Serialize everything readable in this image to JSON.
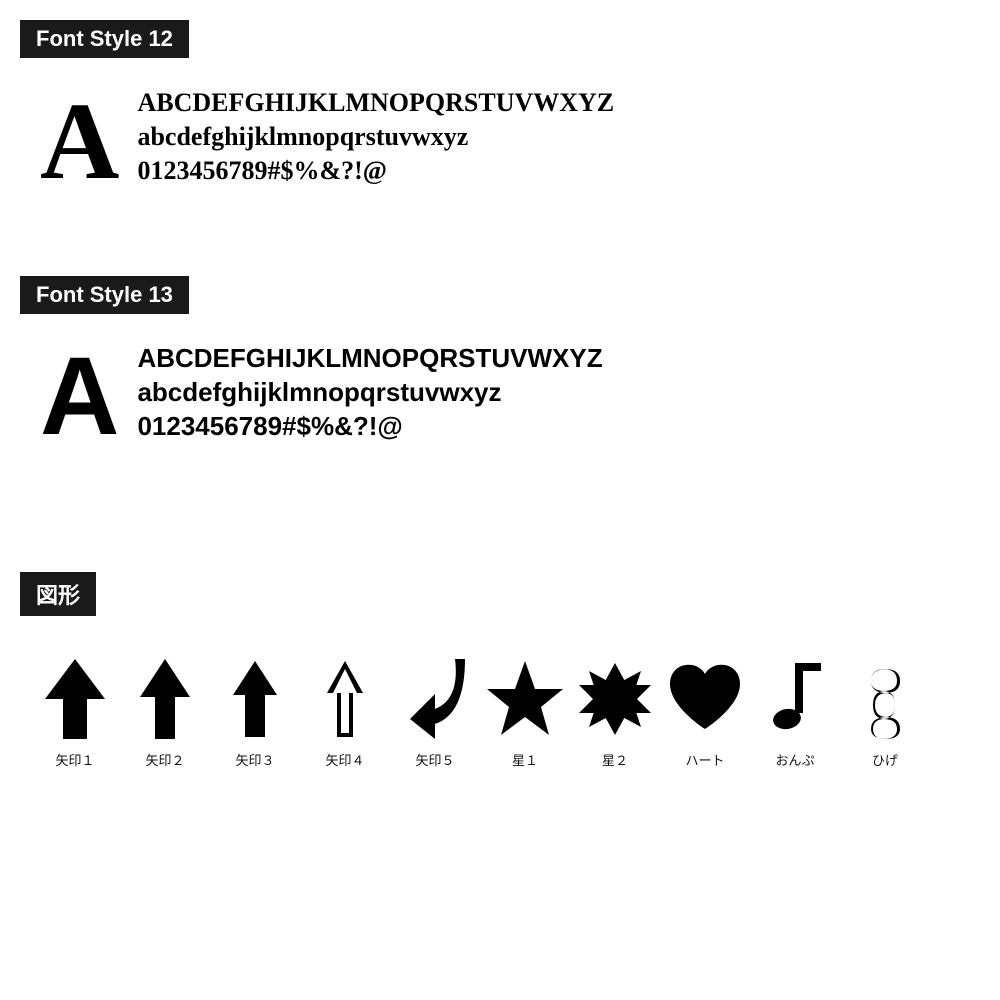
{
  "sections": [
    {
      "id": "font-style-12",
      "label": "Font Style 12",
      "bigA": "A",
      "lines": [
        "ABCDEFGHIJKLMNOPQRSTUVWXYZ",
        "abcdefghijklmnopqrstuvwxyz",
        "0123456789#$%&?!@"
      ],
      "fontClass": "style12-chars"
    },
    {
      "id": "font-style-13",
      "label": "Font Style 13",
      "bigA": "A",
      "lines": [
        "ABCDEFGHIJKLMNOPQRSTUVWXYZ",
        "abcdefghijklmnopqrstuvwxyz",
        "0123456789#$%&?!@"
      ],
      "fontClass": "style13-chars"
    }
  ],
  "shapes": {
    "label": "図形",
    "items": [
      {
        "id": "yajirushi1",
        "label": "矢印１",
        "unicode": "↑",
        "class": "arrow1"
      },
      {
        "id": "yajirushi2",
        "label": "矢印２",
        "unicode": "⬆",
        "class": "arrow2"
      },
      {
        "id": "yajirushi3",
        "label": "矢印３",
        "unicode": "⇑",
        "class": "arrow3"
      },
      {
        "id": "yajirushi4",
        "label": "矢印４",
        "unicode": "⇧",
        "class": "arrow4"
      },
      {
        "id": "yajirushi5",
        "label": "矢印５",
        "unicode": "↩",
        "class": "arrow5"
      },
      {
        "id": "hoshi1",
        "label": "星１",
        "unicode": "★",
        "class": "star1"
      },
      {
        "id": "hoshi2",
        "label": "星２",
        "unicode": "✡",
        "class": "star2"
      },
      {
        "id": "haato",
        "label": "ハート",
        "unicode": "♥",
        "class": "heart"
      },
      {
        "id": "onpu",
        "label": "おんぷ",
        "unicode": "♪",
        "class": "music"
      },
      {
        "id": "hige",
        "label": "ひげ",
        "unicode": "〕",
        "class": "hige"
      }
    ]
  }
}
